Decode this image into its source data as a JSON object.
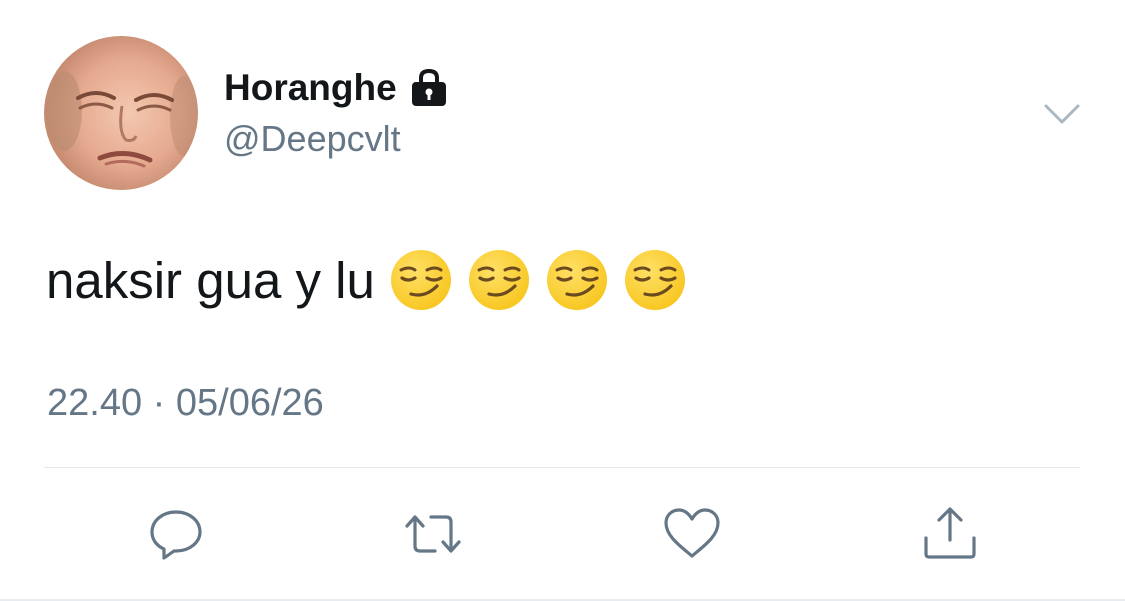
{
  "user": {
    "display_name": "Horanghe",
    "handle": "@Deepcvlt",
    "protected_icon": "lock-icon",
    "avatar": "avatar"
  },
  "tweet": {
    "text": "naksir gua y lu",
    "emojis": [
      "smirking-face",
      "smirking-face",
      "smirking-face",
      "smirking-face"
    ],
    "time": "22.40",
    "separator": "·",
    "date": "05/06/26"
  },
  "menu": {
    "icon": "chevron-down-icon"
  },
  "actions": [
    {
      "name": "reply",
      "icon": "reply-icon"
    },
    {
      "name": "retweet",
      "icon": "retweet-icon"
    },
    {
      "name": "like",
      "icon": "heart-icon"
    },
    {
      "name": "share",
      "icon": "share-icon"
    }
  ],
  "colors": {
    "text_primary": "#14171a",
    "text_secondary": "#657786",
    "icon": "#657786",
    "divider": "#e1e8ed",
    "emoji_face": "#f7c51e"
  }
}
